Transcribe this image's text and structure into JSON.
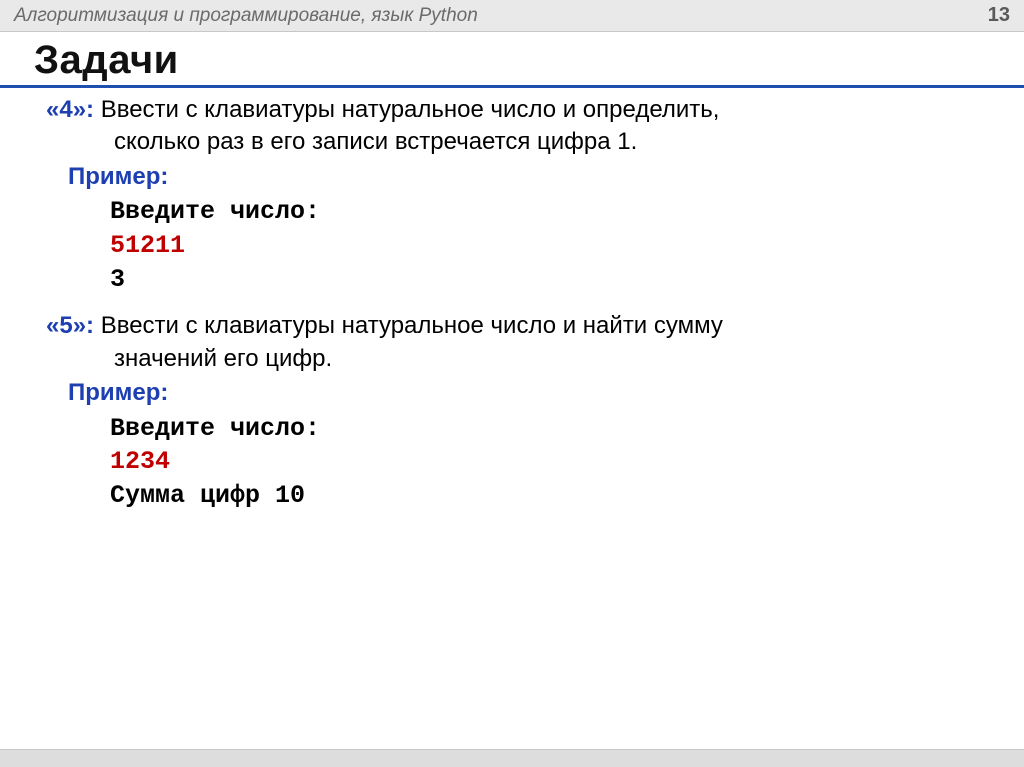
{
  "header": {
    "subject": "Алгоритмизация и программирование, язык Python",
    "page_number": "13"
  },
  "title": "Задачи",
  "tasks": [
    {
      "grade": "«4»:",
      "desc_line1": "Ввести с клавиатуры натуральное число и определить,",
      "desc_line2": "сколько  раз в его записи встречается цифра 1.",
      "example_label": "Пример:",
      "code": {
        "prompt": "Введите число:",
        "input": "51211",
        "output": "3"
      }
    },
    {
      "grade": "«5»:",
      "desc_line1": "Ввести с клавиатуры натуральное число и найти сумму",
      "desc_line2": "значений его цифр.",
      "example_label": "Пример:",
      "code": {
        "prompt": "Введите число:",
        "input": "1234",
        "output": "Сумма цифр 10"
      }
    }
  ]
}
